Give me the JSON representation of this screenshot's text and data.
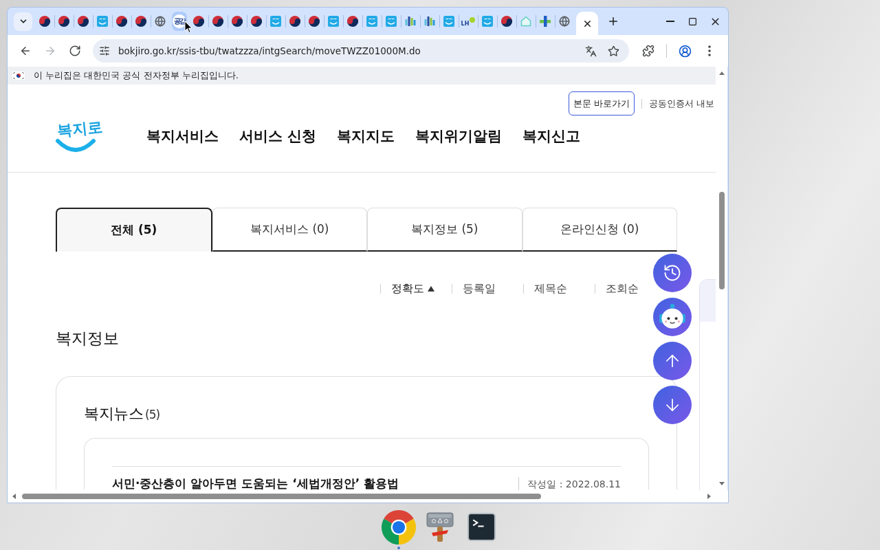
{
  "browser": {
    "tabs": [
      {
        "kind": "emblem",
        "selected": false,
        "highlighted": false
      },
      {
        "kind": "emblem",
        "selected": false,
        "highlighted": false
      },
      {
        "kind": "emblem",
        "selected": false,
        "highlighted": false
      },
      {
        "kind": "bokjiro",
        "selected": false,
        "highlighted": false
      },
      {
        "kind": "emblem",
        "selected": false,
        "highlighted": false
      },
      {
        "kind": "emblem",
        "selected": false,
        "highlighted": false
      },
      {
        "kind": "globe",
        "selected": false,
        "highlighted": false
      },
      {
        "kind": "gonggam",
        "icon_text": "공감",
        "selected": false,
        "highlighted": true
      },
      {
        "kind": "emblem",
        "selected": false,
        "highlighted": false
      },
      {
        "kind": "emblem",
        "selected": false,
        "highlighted": false
      },
      {
        "kind": "emblem",
        "selected": false,
        "highlighted": false
      },
      {
        "kind": "emblem",
        "selected": false,
        "highlighted": false
      },
      {
        "kind": "bokjiro",
        "selected": false,
        "highlighted": false
      },
      {
        "kind": "emblem",
        "selected": false,
        "highlighted": false
      },
      {
        "kind": "emblem",
        "selected": false,
        "highlighted": false
      },
      {
        "kind": "bokjiro",
        "selected": false,
        "highlighted": false
      },
      {
        "kind": "emblem",
        "selected": false,
        "highlighted": false
      },
      {
        "kind": "bokjiro",
        "selected": false,
        "highlighted": false
      },
      {
        "kind": "bokjiro",
        "selected": false,
        "highlighted": false
      },
      {
        "kind": "building",
        "selected": false,
        "highlighted": false
      },
      {
        "kind": "building",
        "selected": false,
        "highlighted": false
      },
      {
        "kind": "bokjiro",
        "selected": false,
        "highlighted": false
      },
      {
        "kind": "lh",
        "icon_text": "LH",
        "selected": false,
        "highlighted": false
      },
      {
        "kind": "bokjiro",
        "selected": false,
        "highlighted": false
      },
      {
        "kind": "emblem",
        "selected": false,
        "highlighted": false
      },
      {
        "kind": "house",
        "selected": false,
        "highlighted": false
      },
      {
        "kind": "cross",
        "selected": false,
        "highlighted": false
      },
      {
        "kind": "globe",
        "selected": false,
        "highlighted": false
      },
      {
        "selected": true
      }
    ],
    "nav_buttons": [
      {
        "kind": "back",
        "disabled": false
      },
      {
        "kind": "forward",
        "disabled": true
      },
      {
        "kind": "reload",
        "disabled": false
      }
    ],
    "url": "bokjiro.go.kr/ssis-tbu/twatzzza/intgSearch/moveTWZZ01000M.do"
  },
  "gov_banner": "이 누리집은 대한민국 공식 전자정부 누리집입니다.",
  "header": {
    "skip_link": "본문 바로가기",
    "utility_link": "공동인증서 내보",
    "logo": "복지로",
    "nav": [
      "복지서비스",
      "서비스 신청",
      "복지지도",
      "복지위기알림",
      "복지신고"
    ]
  },
  "result_tabs": [
    {
      "label": "전체 (5)",
      "selected": true
    },
    {
      "label": "복지서비스 (0)",
      "selected": false
    },
    {
      "label": "복지정보 (5)",
      "selected": false
    },
    {
      "label": "온라인신청 (0)",
      "selected": false
    }
  ],
  "sort_options": [
    {
      "label": "정확도",
      "selected": true
    },
    {
      "label": "등록일",
      "selected": false
    },
    {
      "label": "제목순",
      "selected": false
    },
    {
      "label": "조회순",
      "selected": false
    }
  ],
  "section_title": "복지정보",
  "news": {
    "title": "복지뉴스",
    "count": "(5)",
    "items": [
      {
        "title": "서민·중산층이 알아두면 도움되는 ‘세법개정안’ 활용법",
        "date": "작성일 : 2022.08.11"
      }
    ]
  },
  "floating_buttons": [
    {
      "kind": "history"
    },
    {
      "kind": "chatbot"
    },
    {
      "kind": "scroll_top"
    },
    {
      "kind": "scroll_bottom"
    }
  ],
  "taskbar": [
    {
      "kind": "chrome",
      "running": true
    },
    {
      "kind": "keyboard",
      "running": false
    },
    {
      "kind": "terminal",
      "running": false
    }
  ]
}
